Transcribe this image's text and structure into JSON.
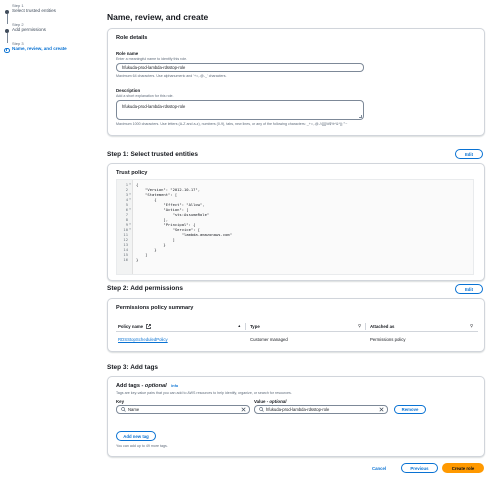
{
  "steps": [
    {
      "num": "Step 1",
      "title": "Select trusted entities"
    },
    {
      "num": "Step 2",
      "title": "Add permissions"
    },
    {
      "num": "Step 3",
      "title": "Name, review, and create"
    }
  ],
  "page_title": "Name, review, and create",
  "role_details": {
    "header": "Role details",
    "name_label": "Role name",
    "name_hint": "Enter a meaningful name to identify this role.",
    "name_value": "hfukuda-prod-lambda-rdsstop-role",
    "name_constraint": "Maximum 64 characters. Use alphanumeric and '+=,.@-_' characters.",
    "desc_label": "Description",
    "desc_hint": "Add a short explanation for this role.",
    "desc_value": "hfukuda-prod-lambda-rdsstop-role",
    "desc_constraint": "Maximum 1000 characters. Use letters (A-Z and a-z), numbers (0-9), tabs, new lines, or any of the following characters: _+=,.@-/\\[{}]!#$%^&*();'\"~"
  },
  "step1": {
    "title": "Step 1: Select trusted entities",
    "edit": "Edit",
    "header": "Trust policy",
    "lines": [
      {
        "n": "1",
        "fold": true,
        "text": "{"
      },
      {
        "n": "2",
        "fold": false,
        "text": "    \"Version\": \"2012-10-17\","
      },
      {
        "n": "3",
        "fold": true,
        "text": "    \"Statement\": ["
      },
      {
        "n": "4",
        "fold": true,
        "text": "        {"
      },
      {
        "n": "5",
        "fold": false,
        "text": "            \"Effect\": \"Allow\","
      },
      {
        "n": "6",
        "fold": true,
        "text": "            \"Action\": ["
      },
      {
        "n": "7",
        "fold": false,
        "text": "                \"sts:AssumeRole\""
      },
      {
        "n": "8",
        "fold": false,
        "text": "            ],"
      },
      {
        "n": "9",
        "fold": true,
        "text": "            \"Principal\": {"
      },
      {
        "n": "10",
        "fold": true,
        "text": "                \"Service\": ["
      },
      {
        "n": "11",
        "fold": false,
        "text": "                    \"lambda.amazonaws.com\""
      },
      {
        "n": "12",
        "fold": false,
        "text": "                ]"
      },
      {
        "n": "13",
        "fold": false,
        "text": "            }"
      },
      {
        "n": "14",
        "fold": false,
        "text": "        }"
      },
      {
        "n": "15",
        "fold": false,
        "text": "    ]"
      },
      {
        "n": "16",
        "fold": false,
        "text": "}"
      }
    ]
  },
  "step2": {
    "title": "Step 2: Add permissions",
    "edit": "Edit",
    "header": "Permissions policy summary",
    "columns": [
      "Policy name",
      "Type",
      "Attached as"
    ],
    "rows": [
      {
        "policy": "RDSStopScheduledPolicy",
        "type": "Customer managed",
        "attached": "Permissions policy"
      }
    ]
  },
  "step3": {
    "title": "Step 3: Add tags",
    "header_prefix": "Add tags - ",
    "header_optional": "optional",
    "info": "Info",
    "description": "Tags are key-value pairs that you can add to AWS resources to help identify, organize, or search for resources.",
    "key_label": "Key",
    "value_label_prefix": "Value - ",
    "value_label_optional": "optional",
    "key_value": "Name",
    "value_value": "hfukuda-prod-lambda-rdsstop-role",
    "remove": "Remove",
    "add_new": "Add new tag",
    "limit_hint": "You can add up to 49 more tags."
  },
  "footer": {
    "cancel": "Cancel",
    "previous": "Previous",
    "create": "Create role"
  },
  "colors": {
    "accent": "#0972d3",
    "primary_button": "#ff9900"
  }
}
